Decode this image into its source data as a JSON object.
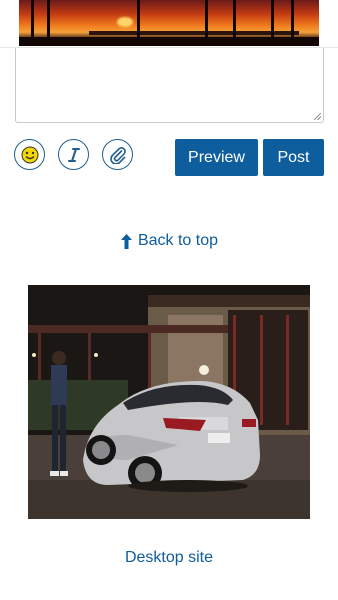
{
  "banner": {
    "alt": "Sunset pier with palm trees"
  },
  "composer": {
    "textarea_value": "",
    "emoji_icon": "smiley-face-icon",
    "italic_icon": "italic-icon",
    "attach_icon": "paperclip-icon",
    "preview_label": "Preview",
    "post_label": "Post"
  },
  "nav": {
    "back_to_top_label": "Back to top",
    "back_to_top_icon": "arrow-up-icon",
    "desktop_site_label": "Desktop site"
  },
  "media": {
    "alt": "Silver sedan parked at night beside a building with a person standing"
  },
  "colors": {
    "link": "#0e5d9c",
    "button": "#0e5d9c",
    "icon_border": "#1f5e8e"
  }
}
